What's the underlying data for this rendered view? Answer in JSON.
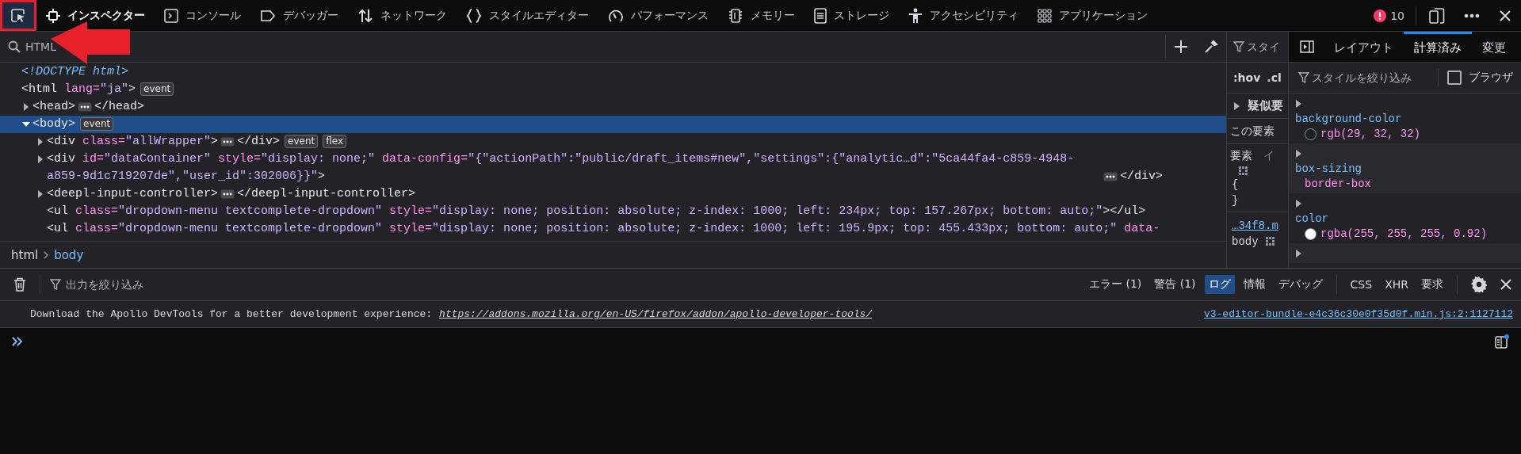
{
  "pointer_arrow": true,
  "toolbar": {
    "pick_button": {
      "selected": true,
      "highlighted": true
    },
    "tabs": [
      {
        "label": "インスペクター",
        "selected": true
      },
      {
        "label": "コンソール",
        "selected": false
      },
      {
        "label": "デバッガー",
        "selected": false
      },
      {
        "label": "ネットワーク",
        "selected": false
      },
      {
        "label": "スタイルエディター",
        "selected": false
      },
      {
        "label": "パフォーマンス",
        "selected": false
      },
      {
        "label": "メモリー",
        "selected": false
      },
      {
        "label": "ストレージ",
        "selected": false
      },
      {
        "label": "アクセシビリティ",
        "selected": false
      },
      {
        "label": "アプリケーション",
        "selected": false
      }
    ],
    "error_count": "10"
  },
  "inspector": {
    "search": {
      "placeholder": "HTML"
    },
    "nodes": [
      {
        "kind": "leaf",
        "selected": false,
        "parts": [
          {
            "kind": "doctype",
            "text": "<!DOCTYPE html>"
          }
        ]
      },
      {
        "kind": "leaf",
        "selected": false,
        "parts": [
          {
            "kind": "tag",
            "text": "<html"
          },
          {
            "kind": "attr",
            "text": "lang="
          },
          {
            "kind": "value",
            "text": "\"ja\""
          },
          {
            "kind": "tag",
            "text": ">"
          },
          {
            "kind": "badge",
            "text": "event"
          }
        ],
        "children": [
          {
            "kind": "parent",
            "expanded": false,
            "selected": false,
            "parts": [
              {
                "kind": "tag",
                "text": "<head>"
              },
              {
                "kind": "more"
              },
              {
                "kind": "tag",
                "text": "</head>"
              }
            ]
          },
          {
            "kind": "parent",
            "expanded": true,
            "selected": true,
            "parts": [
              {
                "kind": "tag",
                "text": "<body>"
              },
              {
                "kind": "badge",
                "text": "event"
              }
            ],
            "children": [
              {
                "kind": "parent",
                "expanded": false,
                "selected": false,
                "parts": [
                  {
                    "kind": "tag",
                    "text": "<div"
                  },
                  {
                    "kind": "attr",
                    "text": "class="
                  },
                  {
                    "kind": "value",
                    "text": "\"allWrapper\""
                  },
                  {
                    "kind": "tag",
                    "text": ">"
                  },
                  {
                    "kind": "more"
                  },
                  {
                    "kind": "tag",
                    "text": "</div>"
                  },
                  {
                    "kind": "badge",
                    "text": "event"
                  },
                  {
                    "kind": "badge",
                    "text": "flex"
                  }
                ]
              },
              {
                "kind": "parent",
                "expanded": false,
                "selected": false,
                "parts": [
                  {
                    "kind": "tag",
                    "text": "<div"
                  },
                  {
                    "kind": "attr",
                    "text": "id="
                  },
                  {
                    "kind": "value",
                    "text": "\"dataContainer\""
                  },
                  {
                    "kind": "attr",
                    "text": "style="
                  },
                  {
                    "kind": "value",
                    "text": "\"display: none;\""
                  },
                  {
                    "kind": "attr",
                    "text": "data-config="
                  },
                  {
                    "kind": "value",
                    "text": "\"{\"actionPath\":\"public/draft_items#new\",\"settings\":{\"analytic…d\":\"5ca44fa4-c859-4948-a859-9d1c719207de\",\"user_id\":302006}}\""
                  },
                  {
                    "kind": "tag",
                    "text": ">"
                  },
                  {
                    "kind": "more"
                  },
                  {
                    "kind": "tag",
                    "text": "</div>"
                  }
                ]
              },
              {
                "kind": "parent",
                "expanded": false,
                "selected": false,
                "parts": [
                  {
                    "kind": "tag",
                    "text": "<deepl-input-controller>"
                  },
                  {
                    "kind": "more"
                  },
                  {
                    "kind": "tag",
                    "text": "</deepl-input-controller>"
                  }
                ]
              },
              {
                "kind": "leaf",
                "selected": false,
                "parts": [
                  {
                    "kind": "tag",
                    "text": "<ul"
                  },
                  {
                    "kind": "attr",
                    "text": "class="
                  },
                  {
                    "kind": "value",
                    "text": "\"dropdown-menu textcomplete-dropdown\""
                  },
                  {
                    "kind": "attr",
                    "text": "style="
                  },
                  {
                    "kind": "value",
                    "text": "\"display: none; position: absolute; z-index: 1000; left: 234px; top: 157.267px; bottom: auto;\""
                  },
                  {
                    "kind": "tag",
                    "text": "></ul>"
                  }
                ]
              },
              {
                "kind": "leaf",
                "selected": false,
                "parts": [
                  {
                    "kind": "tag",
                    "text": "<ul"
                  },
                  {
                    "kind": "attr",
                    "text": "class="
                  },
                  {
                    "kind": "value",
                    "text": "\"dropdown-menu textcomplete-dropdown\""
                  },
                  {
                    "kind": "attr",
                    "text": "style="
                  },
                  {
                    "kind": "value",
                    "text": "\"display: none; position: absolute; z-index: 1000; left: 195.9px; top: 455.433px; bottom: auto;\""
                  },
                  {
                    "kind": "attr",
                    "text": "data-"
                  }
                ]
              }
            ]
          }
        ]
      }
    ],
    "breadcrumbs": [
      {
        "label": "html",
        "selected": false
      },
      {
        "label": "body",
        "selected": true
      }
    ]
  },
  "rules": {
    "filter": {
      "placeholder": "スタイ"
    },
    "toggles": [
      ":hov",
      ".cl"
    ],
    "pseudo": {
      "label": "疑似要",
      "expanded": false
    },
    "this_element": "この要素",
    "element_label": "要素",
    "element_extra": "イ",
    "open_brace": "{",
    "close_brace": "}",
    "source_link": "…34f8.m",
    "selector": "body"
  },
  "computed": {
    "tabs": [
      {
        "label": "レイアウト",
        "selected": false
      },
      {
        "label": "計算済み",
        "selected": true
      },
      {
        "label": "変更",
        "selected": false
      }
    ],
    "filter": {
      "placeholder": "スタイルを絞り込み"
    },
    "browser_styles": {
      "label": "ブラウザ",
      "checked": false
    },
    "properties": [
      {
        "name": "background-color",
        "value": "rgb(29, 32, 32)",
        "color": "#1d2020"
      },
      {
        "name": "box-sizing",
        "value": "border-box"
      },
      {
        "name": "color",
        "value": "rgba(255, 255, 255, 0.92)",
        "color": "#ffffff"
      }
    ]
  },
  "console": {
    "filter": {
      "placeholder": "出力を絞り込み"
    },
    "levels": [
      {
        "label": "エラー (1)",
        "selected": false
      },
      {
        "label": "警告 (1)",
        "selected": false
      },
      {
        "label": "ログ",
        "selected": true
      },
      {
        "label": "情報",
        "selected": false
      },
      {
        "label": "デバッグ",
        "selected": false
      }
    ],
    "requests": [
      {
        "label": "CSS",
        "selected": false
      },
      {
        "label": "XHR",
        "selected": false
      },
      {
        "label": "要求",
        "selected": false
      }
    ],
    "messages": [
      {
        "text": "Download the Apollo DevTools for a better development experience:",
        "link": "https://addons.mozilla.org/en-US/firefox/addon/apollo-developer-tools/",
        "source": "v3-editor-bundle-e4c36c30e0f35d0f.min.js:2:1127112"
      }
    ]
  }
}
